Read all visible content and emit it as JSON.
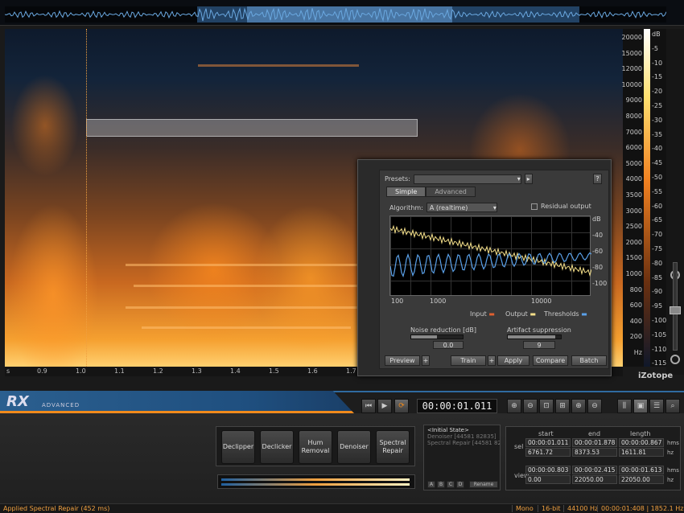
{
  "freq_scale": [
    "20000",
    "15000",
    "12000",
    "10000",
    "9000",
    "8000",
    "7000",
    "6000",
    "5000",
    "4000",
    "3500",
    "3000",
    "2500",
    "2000",
    "1500",
    "1000",
    "800",
    "600",
    "400",
    "200",
    "Hz"
  ],
  "db_scale": [
    "dB",
    "-5",
    "-10",
    "-15",
    "-20",
    "-25",
    "-30",
    "-35",
    "-40",
    "-45",
    "-50",
    "-55",
    "-60",
    "-65",
    "-70",
    "-75",
    "-80",
    "-85",
    "-90",
    "-95",
    "-100",
    "-105",
    "-110",
    "-115"
  ],
  "time_axis": [
    "s",
    "0.9",
    "1.0",
    "1.1",
    "1.2",
    "1.3",
    "1.4",
    "1.5",
    "1.6",
    "1.7"
  ],
  "brand": {
    "rx": "RX",
    "edition": "ADVANCED",
    "logo": "iZotope"
  },
  "timecode": "00:00:01.011",
  "dialog": {
    "presets_label": "Presets:",
    "help": "?",
    "tabs": [
      "Simple",
      "Advanced"
    ],
    "algorithm_label": "Algorithm:",
    "algorithm_value": "A (realtime)",
    "residual_label": "Residual output",
    "graph_y": [
      "dB",
      "-40",
      "-60",
      "-80",
      "-100"
    ],
    "graph_x": [
      "100",
      "1000",
      "10000"
    ],
    "legend": {
      "input": "Input",
      "output": "Output",
      "thresholds": "Thresholds"
    },
    "noise_reduction_label": "Noise reduction [dB]",
    "noise_reduction_value": "0.0",
    "noise_reduction_level": 0.5,
    "artifact_label": "Artifact suppression",
    "artifact_value": "9",
    "artifact_level": 0.9,
    "buttons": {
      "preview": "Preview",
      "train": "Train",
      "apply": "Apply",
      "compare": "Compare",
      "batch": "Batch",
      "plus": "+"
    }
  },
  "modules": [
    {
      "label": "Declipper"
    },
    {
      "label": "Declicker"
    },
    {
      "label": "Hum Removal"
    },
    {
      "label": "Denoiser"
    },
    {
      "label": "Spectral Repair"
    }
  ],
  "history": {
    "items": [
      "<Initial State>",
      "Denoiser [44581 82835]",
      "Spectral Repair [44581 82835]"
    ],
    "buttons": [
      "A",
      "B",
      "C",
      "D",
      "Rename"
    ]
  },
  "selection": {
    "headers": [
      "start",
      "end",
      "length"
    ],
    "sel_label": "sel",
    "view_label": "view",
    "sel_time": [
      "00:00:01.011",
      "00:00:01.878",
      "00:00:00.867"
    ],
    "sel_hz": [
      "6761.72",
      "8373.53",
      "1611.81"
    ],
    "view_time": [
      "00:00:00.803",
      "00:00:02.415",
      "00:00:01.613"
    ],
    "view_hz": [
      "0.00",
      "22050.00",
      "22050.00"
    ],
    "units": [
      "hms",
      "hz",
      "hms",
      "hz"
    ]
  },
  "status": {
    "message": "Applied Spectral Repair (452 ms)",
    "channels": "Mono",
    "bitdepth": "16-bit",
    "samplerate": "44100 Hz",
    "cursor": "00:00:01:408 | 1852.1 Hz"
  }
}
